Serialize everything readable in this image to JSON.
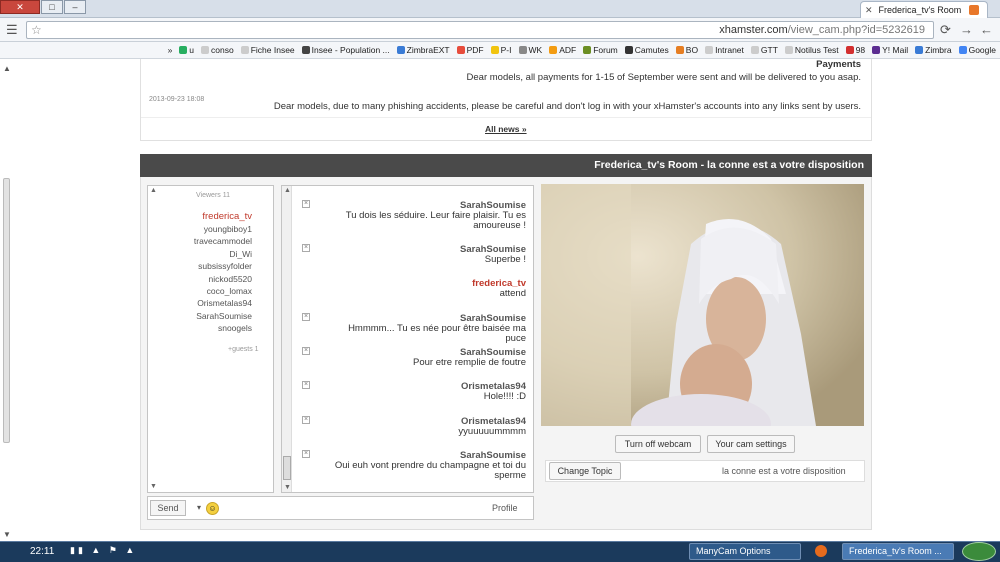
{
  "browser": {
    "tab_title": "Frederica_tv's Room",
    "url_host": "xhamster.com",
    "url_path": "/view_cam.php?id=5232619",
    "bookmarks": [
      "Google",
      "Zimbra",
      "Y! Mail",
      "98",
      "Notilus Test",
      "GTT",
      "Intranet",
      "BO",
      "Camutes",
      "Forum",
      "ADF",
      "WK",
      "P-I",
      "PDF",
      "ZimbraEXT",
      "Insee - Population ...",
      "Fiche Insee",
      "conso",
      "u"
    ]
  },
  "news": {
    "items": [
      {
        "text": "Payments",
        "date": ""
      },
      {
        "text": "Dear models, all payments for 1-15 of September were sent and will be delivered to you asap.",
        "date": ""
      },
      {
        "text": "Dear models, due to many phishing accidents, please be careful and don't log in with your xHamster's accounts into any links sent by users.",
        "date": "2013-09-23 18:08"
      }
    ],
    "all_news": "All news »"
  },
  "room": {
    "title": "Frederica_tv's Room - la conne est a votre disposition",
    "viewers_label": "Viewers 11",
    "guests_label": "+guests 1",
    "users": [
      {
        "name": "frederica_tv",
        "owner": true
      },
      {
        "name": "youngbiboy1",
        "owner": false
      },
      {
        "name": "travecammodel",
        "owner": false
      },
      {
        "name": "Di_Wi",
        "owner": false
      },
      {
        "name": "subsissyfolder",
        "owner": false
      },
      {
        "name": "nickod5520",
        "owner": false
      },
      {
        "name": "coco_lomax",
        "owner": false
      },
      {
        "name": "Orismetalas94",
        "owner": false
      },
      {
        "name": "SarahSoumise",
        "owner": false
      },
      {
        "name": "snoogels",
        "owner": false
      }
    ],
    "messages": [
      {
        "author": "SarahSoumise",
        "text": "Tu dois les séduire. Leur faire plaisir. Tu es amoureuse !",
        "owner": false
      },
      {
        "author": "SarahSoumise",
        "text": "Superbe !",
        "owner": false
      },
      {
        "author": "frederica_tv",
        "text": "attend",
        "owner": true
      },
      {
        "author": "SarahSoumise",
        "text": "Hmmmm... Tu es née pour être baisée ma puce",
        "owner": false
      },
      {
        "author": "SarahSoumise",
        "text": "Pour etre remplie de foutre",
        "owner": false
      },
      {
        "author": "Orismetalas94",
        "text": "Hole!!!! :D",
        "owner": false
      },
      {
        "author": "Orismetalas94",
        "text": "yyuuuuummmm",
        "owner": false
      },
      {
        "author": "SarahSoumise",
        "text": "Oui euh vont prendre du champagne et toi du sperme",
        "owner": false
      }
    ],
    "profile_label": "Profile",
    "send_label": "Send",
    "cam_settings": "Your cam settings",
    "webcam_off": "Turn off webcam",
    "topic": "la conne est a votre disposition",
    "change_topic": "Change Topic"
  },
  "taskbar": {
    "tasks": [
      "Frederica_tv's Room ...",
      "ManyCam Options"
    ],
    "clock": "22:11"
  }
}
